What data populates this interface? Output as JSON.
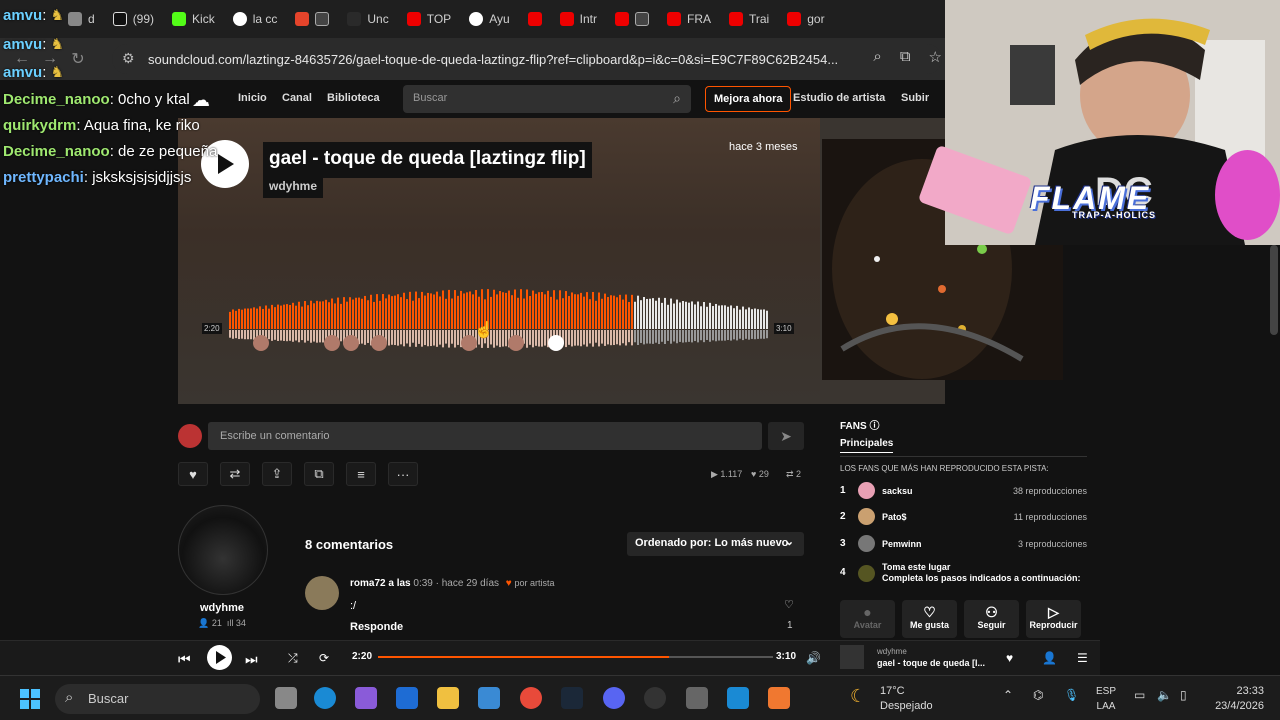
{
  "browser": {
    "tabs": [
      "d",
      "(99)",
      "Kick",
      "la cc",
      "",
      "Unc",
      "TOP",
      "Ayu",
      "",
      "Intr",
      "",
      "FRA",
      "Trai",
      "gor"
    ],
    "url": "soundcloud.com/laztingz-84635726/gael-toque-de-queda-laztingz-flip?ref=clipboard&p=i&c=0&si=E9C7F89C62B2454..."
  },
  "chat": [
    {
      "user": "amvu",
      "text": "",
      "color": "#6bd0ff"
    },
    {
      "user": "amvu",
      "text": "",
      "color": "#6bd0ff"
    },
    {
      "user": "amvu",
      "text": "",
      "color": "#6bd0ff"
    },
    {
      "user": "Decime_nanoo",
      "text": "0cho y ktal",
      "color": "#9fe870"
    },
    {
      "user": "quirkydrm",
      "text": "Aqua fina, ke riko",
      "color": "#9fe870"
    },
    {
      "user": "Decime_nanoo",
      "text": "de ze pequeña",
      "color": "#9fe870"
    },
    {
      "user": "prettypachi",
      "text": "jsksksjsjsjdjjsjs",
      "color": "#6fb7ff"
    }
  ],
  "sc_header": {
    "home": "Inicio",
    "feed": "Canal",
    "library": "Biblioteca",
    "search_placeholder": "Buscar",
    "upgrade": "Mejora ahora",
    "artist_studio": "Estudio de artista",
    "upload": "Subir"
  },
  "track": {
    "title": "gael - toque de queda [laztingz flip]",
    "artist": "wdyhme",
    "posted": "hace 3 meses",
    "elapsed": "2:20",
    "duration": "3:10",
    "progress": 0.737
  },
  "comment_box": {
    "placeholder": "Escribe un comentario"
  },
  "stats": {
    "plays": "1.117",
    "likes": "29",
    "reposts": "2"
  },
  "uploader": {
    "name": "wdyhme",
    "followers": "21",
    "tracks": "34"
  },
  "comments": {
    "count_label": "8 comentarios",
    "sort_label": "Ordenado por: Lo más nuevo",
    "items": [
      {
        "user": "roma72 a las",
        "time": "0:39",
        "ago": "· hace 29 días",
        "by_artist": "por artista",
        "text": ":/",
        "reply": "Responde",
        "likes": "1"
      }
    ]
  },
  "fans": {
    "title": "FANS",
    "tab": "Principales",
    "subtitle": "LOS FANS QUE MÁS HAN REPRODUCIDO ESTA PISTA:",
    "list": [
      {
        "rank": "1",
        "name": "sacksu",
        "plays": "38 reproducciones",
        "color": "#e8a0b4"
      },
      {
        "rank": "2",
        "name": "Pato$",
        "plays": "11 reproducciones",
        "color": "#caa070"
      },
      {
        "rank": "3",
        "name": "Pemwinn",
        "plays": "3 reproducciones",
        "color": "#777777"
      }
    ],
    "claim": {
      "rank": "4",
      "title": "Toma este lugar",
      "desc": "Completa los pasos indicados a continuación:"
    },
    "actions": [
      "Avatar",
      "Me gusta",
      "Seguir",
      "Reproducir"
    ]
  },
  "player": {
    "elapsed": "2:20",
    "duration": "3:10",
    "artist": "wdyhme",
    "track": "gael - toque de queda [l...",
    "progress": 0.737
  },
  "stream_overlay": {
    "brand": "FLAME",
    "sub": "TRAP-A-HOLICS"
  },
  "taskbar": {
    "search": "Buscar",
    "temp": "17°C",
    "weather": "Despejado",
    "lang1": "ESP",
    "lang2": "LAA",
    "time": "23:33",
    "date": "23/4/2026"
  },
  "colors": {
    "accent": "#ff5500",
    "bg": "#121212"
  }
}
